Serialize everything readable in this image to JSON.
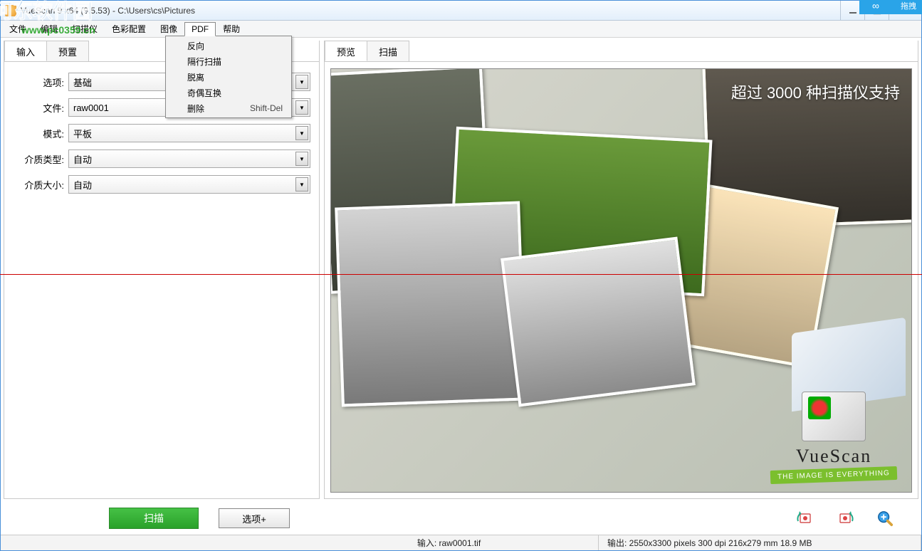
{
  "title": "VueScan 9 x64 (9.5.53) - C:\\Users\\cs\\Pictures",
  "watermark": {
    "text": "河东软件园",
    "url": "www.pc0359.cn"
  },
  "top_badge": {
    "icon": "∞",
    "label": "拖拽"
  },
  "menubar": [
    "文件",
    "编辑",
    "扫描仪",
    "色彩配置",
    "图像",
    "PDF",
    "帮助"
  ],
  "menubar_open_index": 5,
  "dropdown": {
    "items": [
      {
        "label": "反向",
        "shortcut": ""
      },
      {
        "label": "隔行扫描",
        "shortcut": ""
      },
      {
        "label": "脱离",
        "shortcut": ""
      },
      {
        "label": "奇偶互换",
        "shortcut": ""
      },
      {
        "label": "删除",
        "shortcut": "Shift-Del"
      }
    ]
  },
  "left_tabs": [
    {
      "label": "输入",
      "active": true
    },
    {
      "label": "预置",
      "active": false
    }
  ],
  "right_tabs": [
    {
      "label": "预览",
      "active": true
    },
    {
      "label": "扫描",
      "active": false
    }
  ],
  "form": {
    "option_label": "选项:",
    "option_value": "基础",
    "file_label": "文件:",
    "file_value": "raw0001",
    "mode_label": "模式:",
    "mode_value": "平板",
    "media_type_label": "介质类型:",
    "media_type_value": "自动",
    "media_size_label": "介质大小:",
    "media_size_value": "自动"
  },
  "preview_overlay": "超过 3000 种扫描仪支持",
  "logo": {
    "brand": "VueScan",
    "tag": "THE IMAGE IS EVERYTHING"
  },
  "buttons": {
    "scan": "扫描",
    "options_plus": "选项+"
  },
  "status": {
    "input": "输入: raw0001.tif",
    "output": "输出: 2550x3300 pixels 300 dpi 216x279 mm 18.9 MB"
  }
}
